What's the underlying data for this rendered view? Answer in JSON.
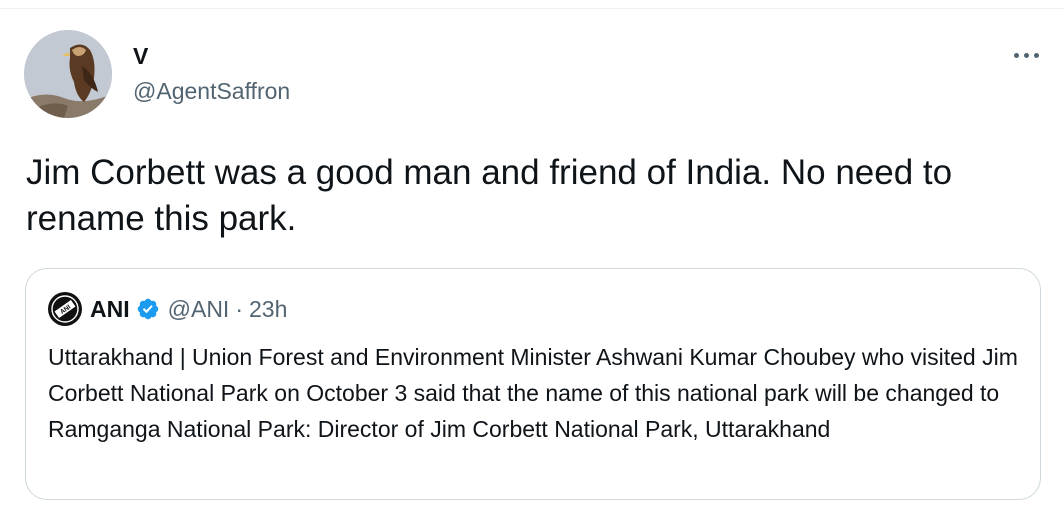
{
  "tweet": {
    "display_name": "V",
    "handle": "@AgentSaffron",
    "text": "Jim Corbett was a good man and friend of India. No need to rename this park.",
    "more_icon": "more-horizontal-icon"
  },
  "quoted_tweet": {
    "display_name": "ANI",
    "handle": "@ANI",
    "separator": "·",
    "time": "23h",
    "verified_icon": "verified-badge-icon",
    "verified_color": "#1d9bf0",
    "text": "Uttarakhand | Union Forest and Environment Minister Ashwani Kumar Choubey who visited Jim Corbett National Park on October 3 said that the name of this national park will be changed to Ramganga National Park: Director of Jim Corbett National Park, Uttarakhand",
    "avatar_logo_text": "ANI"
  },
  "colors": {
    "text_primary": "#0f1419",
    "text_secondary": "#536471",
    "border": "#cfd9de"
  }
}
